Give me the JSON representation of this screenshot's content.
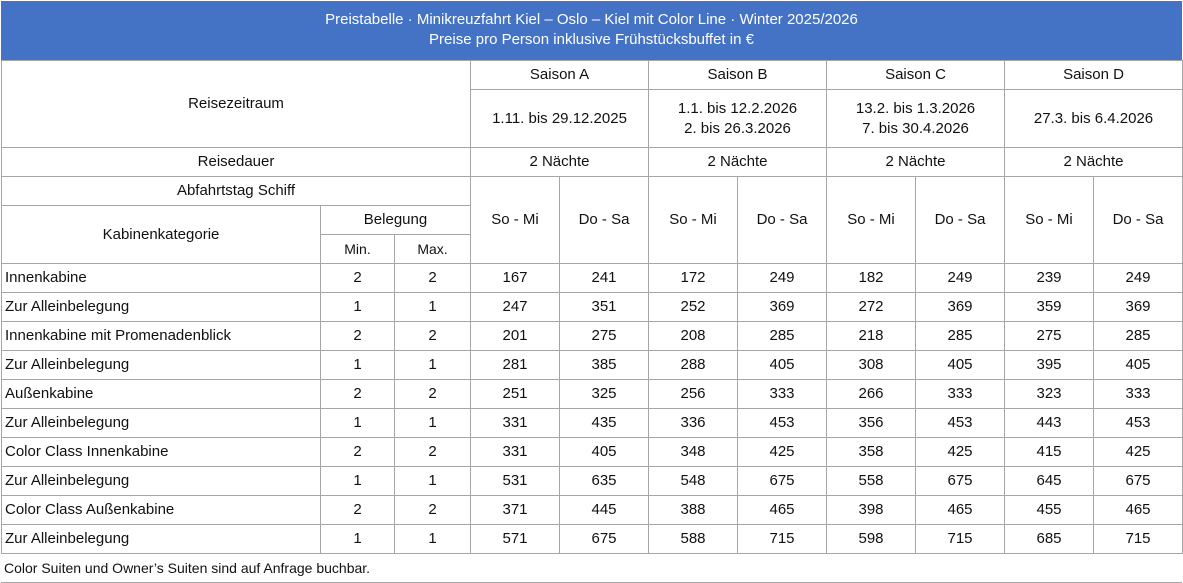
{
  "header": {
    "title": "Preistabelle · Minikreuzfahrt Kiel – Oslo – Kiel mit Color Line · Winter 2025/2026",
    "subtitle": "Preise pro Person inklusive Frühstücksbuffet in €"
  },
  "labels": {
    "reisezeitraum": "Reisezeitraum",
    "reisedauer": "Reisedauer",
    "abfahrtstag": "Abfahrtstag Schiff",
    "kabinenkategorie": "Kabinenkategorie",
    "belegung": "Belegung",
    "min": "Min.",
    "max": "Max."
  },
  "seasons": [
    {
      "name": "Saison A",
      "dates1": "1.11. bis 29.12.2025",
      "dates2": "",
      "duration": "2 Nächte",
      "day1": "So - Mi",
      "day2": "Do - Sa"
    },
    {
      "name": "Saison B",
      "dates1": "1.1. bis 12.2.2026",
      "dates2": "2. bis 26.3.2026",
      "duration": "2 Nächte",
      "day1": "So - Mi",
      "day2": "Do - Sa"
    },
    {
      "name": "Saison C",
      "dates1": "13.2. bis 1.3.2026",
      "dates2": "7. bis 30.4.2026",
      "duration": "2 Nächte",
      "day1": "So - Mi",
      "day2": "Do - Sa"
    },
    {
      "name": "Saison D",
      "dates1": "27.3. bis 6.4.2026",
      "dates2": "",
      "duration": "2 Nächte",
      "day1": "So - Mi",
      "day2": "Do - Sa"
    }
  ],
  "rows": [
    {
      "cabin": "Innenkabine",
      "min": "2",
      "max": "2",
      "p": [
        "167",
        "241",
        "172",
        "249",
        "182",
        "249",
        "239",
        "249"
      ]
    },
    {
      "cabin": "Zur Alleinbelegung",
      "min": "1",
      "max": "1",
      "p": [
        "247",
        "351",
        "252",
        "369",
        "272",
        "369",
        "359",
        "369"
      ]
    },
    {
      "cabin": "Innenkabine mit Promenadenblick",
      "min": "2",
      "max": "2",
      "p": [
        "201",
        "275",
        "208",
        "285",
        "218",
        "285",
        "275",
        "285"
      ]
    },
    {
      "cabin": "Zur Alleinbelegung",
      "min": "1",
      "max": "1",
      "p": [
        "281",
        "385",
        "288",
        "405",
        "308",
        "405",
        "395",
        "405"
      ]
    },
    {
      "cabin": "Außenkabine",
      "min": "2",
      "max": "2",
      "p": [
        "251",
        "325",
        "256",
        "333",
        "266",
        "333",
        "323",
        "333"
      ]
    },
    {
      "cabin": "Zur Alleinbelegung",
      "min": "1",
      "max": "1",
      "p": [
        "331",
        "435",
        "336",
        "453",
        "356",
        "453",
        "443",
        "453"
      ]
    },
    {
      "cabin": "Color Class Innenkabine",
      "min": "2",
      "max": "2",
      "p": [
        "331",
        "405",
        "348",
        "425",
        "358",
        "425",
        "415",
        "425"
      ]
    },
    {
      "cabin": "Zur Alleinbelegung",
      "min": "1",
      "max": "1",
      "p": [
        "531",
        "635",
        "548",
        "675",
        "558",
        "675",
        "645",
        "675"
      ]
    },
    {
      "cabin": "Color Class Außenkabine",
      "min": "2",
      "max": "2",
      "p": [
        "371",
        "445",
        "388",
        "465",
        "398",
        "465",
        "455",
        "465"
      ]
    },
    {
      "cabin": "Zur Alleinbelegung",
      "min": "1",
      "max": "1",
      "p": [
        "571",
        "675",
        "588",
        "715",
        "598",
        "715",
        "685",
        "715"
      ]
    }
  ],
  "footnote": "Color Suiten und Owner’s Suiten sind auf Anfrage buchbar.",
  "colors": {
    "header_bg": "#4472c4",
    "header_text": "#ffffff",
    "border": "#a6a6a6"
  }
}
